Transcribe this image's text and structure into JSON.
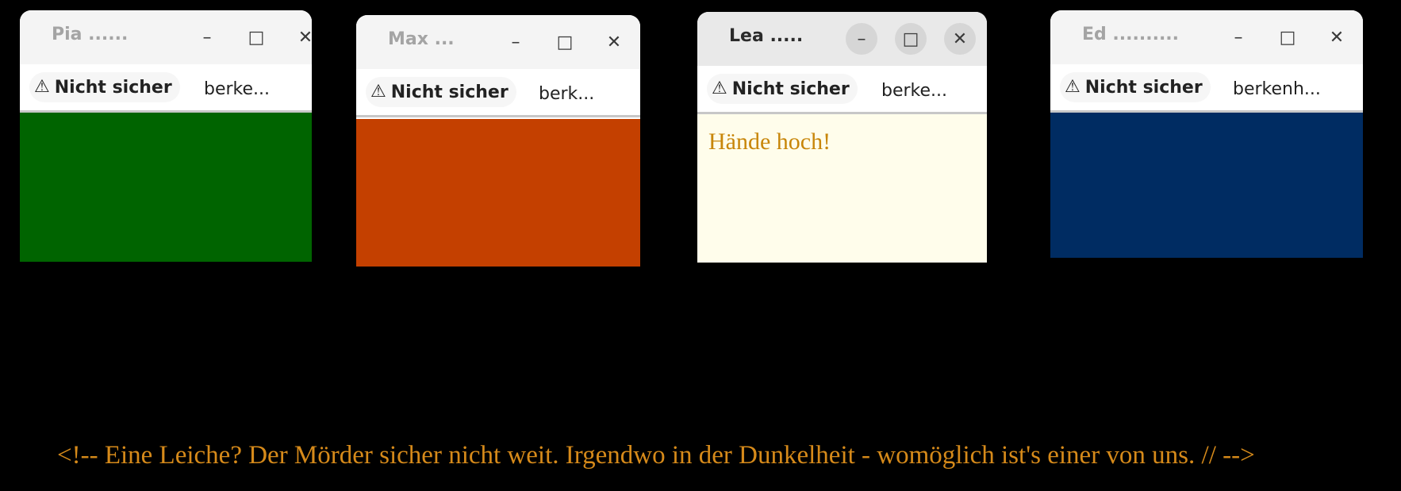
{
  "windows": [
    {
      "title": "Pia ......",
      "security": "Nicht sicher",
      "url": "berke...",
      "content_color": "#006400",
      "content_text": ""
    },
    {
      "title": "Max ...",
      "security": "Nicht sicher",
      "url": "berk...",
      "content_color": "#c44000",
      "content_text": ""
    },
    {
      "title": "Lea .....",
      "security": "Nicht sicher",
      "url": "berke...",
      "content_color": "#fffdeb",
      "content_text": "Hände hoch!"
    },
    {
      "title": "Ed ..........",
      "security": "Nicht sicher",
      "url": "berkenh...",
      "content_color": "#002c62",
      "content_text": ""
    }
  ],
  "icons": {
    "warning": "warning-triangle-icon",
    "minimize": "minimize-icon",
    "maximize": "maximize-icon",
    "close": "close-icon"
  },
  "glyphs": {
    "warning": "⚠",
    "minimize": "–",
    "maximize": "□",
    "close": "✕"
  },
  "comment_text": "<!-- Eine Leiche? Der Mörder sicher nicht weit. Irgendwo in der Dunkelheit - womöglich ist's einer von uns. // -->"
}
